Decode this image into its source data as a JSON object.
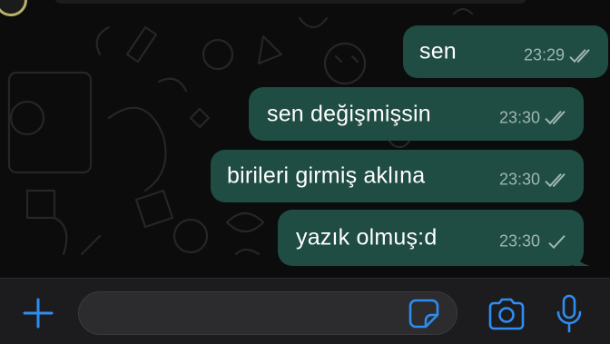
{
  "chat": {
    "messages": [
      {
        "text": "sen",
        "time": "23:29",
        "status": "read"
      },
      {
        "text": "sen değişmişsin",
        "time": "23:30",
        "status": "read"
      },
      {
        "text": "birileri girmiş aklına",
        "time": "23:30",
        "status": "read"
      },
      {
        "text": "yazık olmuş:d",
        "time": "23:30",
        "status": "delivered"
      }
    ]
  },
  "composer": {
    "input_placeholder": "",
    "icons": [
      "plus-icon",
      "sticker-icon",
      "camera-icon",
      "mic-icon"
    ]
  },
  "colors": {
    "background": "#0c0c0c",
    "outgoing_bubble": "#1f4c43",
    "accent": "#2f8cf0",
    "tick": "#9fb6b0"
  }
}
